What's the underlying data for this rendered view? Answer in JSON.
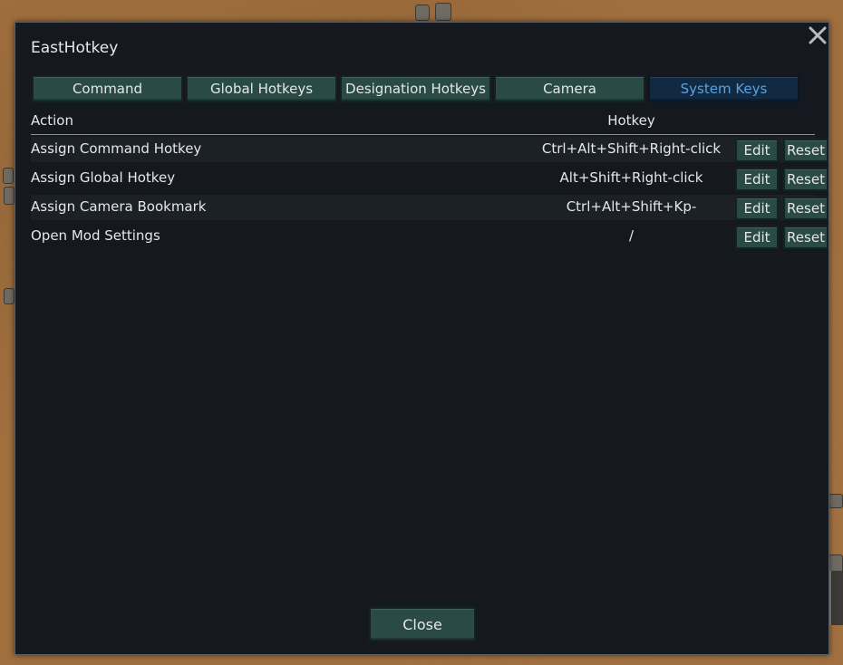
{
  "window": {
    "title": "EastHotkey"
  },
  "tabs": [
    {
      "label": "Command",
      "active": false
    },
    {
      "label": "Global Hotkeys",
      "active": false
    },
    {
      "label": "Designation Hotkeys",
      "active": false
    },
    {
      "label": "Camera",
      "active": false
    },
    {
      "label": "System Keys",
      "active": true
    }
  ],
  "table": {
    "headers": {
      "action": "Action",
      "hotkey": "Hotkey"
    },
    "rows": [
      {
        "action": "Assign Command Hotkey",
        "hotkey": "Ctrl+Alt+Shift+Right-click",
        "edit": "Edit",
        "reset": "Reset"
      },
      {
        "action": "Assign Global Hotkey",
        "hotkey": "Alt+Shift+Right-click",
        "edit": "Edit",
        "reset": "Reset"
      },
      {
        "action": "Assign Camera Bookmark",
        "hotkey": "Ctrl+Alt+Shift+Kp-",
        "edit": "Edit",
        "reset": "Reset"
      },
      {
        "action": "Open Mod Settings",
        "hotkey": "/",
        "edit": "Edit",
        "reset": "Reset"
      }
    ]
  },
  "footer": {
    "close_label": "Close"
  },
  "colors": {
    "button": "#2a4a45",
    "active_tab": "#112941",
    "active_tab_text": "#5ba3e0",
    "window_bg": "#15191f",
    "ground": "#a06f3e"
  },
  "icons": {
    "close": "close-x-icon"
  }
}
